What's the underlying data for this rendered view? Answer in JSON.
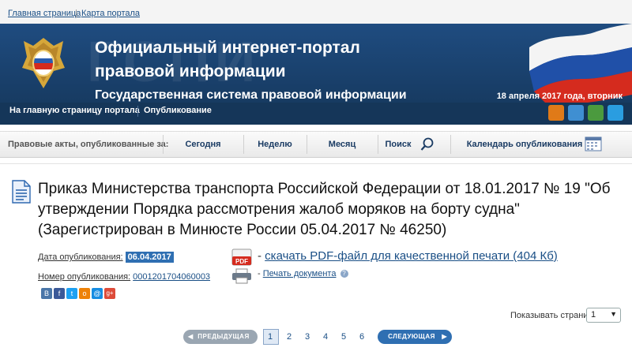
{
  "top_links": {
    "home": "Главная страница",
    "separator": "|",
    "portal_map": "Карта портала"
  },
  "banner": {
    "title_line1": "Официальный интернет-портал",
    "title_line2": "правовой информации",
    "subtitle": "Государственная система правовой информации",
    "date": "18 апреля 2017 года, вторник",
    "colors": {
      "banner": "#1f4c80",
      "subnav": "#153659"
    }
  },
  "subnav": {
    "home": "На главную страницу портала",
    "published": "Опубликование"
  },
  "social_icons": [
    "rss-icon",
    "code-icon",
    "od-icon",
    "twitter-icon"
  ],
  "filter": {
    "label": "Правовые акты, опубликованные за:",
    "today": "Сегодня",
    "week": "Неделю",
    "month": "Месяц",
    "search": "Поиск",
    "calendar": "Календарь опубликования"
  },
  "document": {
    "title": "Приказ Министерства транспорта Российской Федерации от 18.01.2017 № 19 \"Об утверждении Порядка рассмотрения жалоб моряков на борту судна\" (Зарегистрирован в Минюсте России 05.04.2017 № 46250)",
    "pub_date_label": "Дата опубликования:",
    "pub_date": "06.04.2017",
    "pub_number_label": "Номер опубликования:",
    "pub_number": "0001201704060003",
    "pdf_prefix": "-",
    "pdf_link": "скачать PDF-файл для качественной печати (404 Кб)",
    "print_prefix": "-",
    "print_link": "Печать документа",
    "share_icons": [
      "vk-icon",
      "facebook-icon",
      "twitter-icon",
      "odnoklassniki-icon",
      "mailru-icon",
      "googleplus-icon"
    ],
    "share_letters": [
      "В",
      "f",
      "t",
      "о",
      "@",
      "g+"
    ]
  },
  "pagination": {
    "show_pages_label": "Показывать страниц:",
    "show_pages_value": "1",
    "prev": "ПРЕДЫДУЩАЯ",
    "next": "СЛЕДУЮЩАЯ",
    "pages": [
      "1",
      "2",
      "3",
      "4",
      "5",
      "6"
    ],
    "current": "1"
  }
}
